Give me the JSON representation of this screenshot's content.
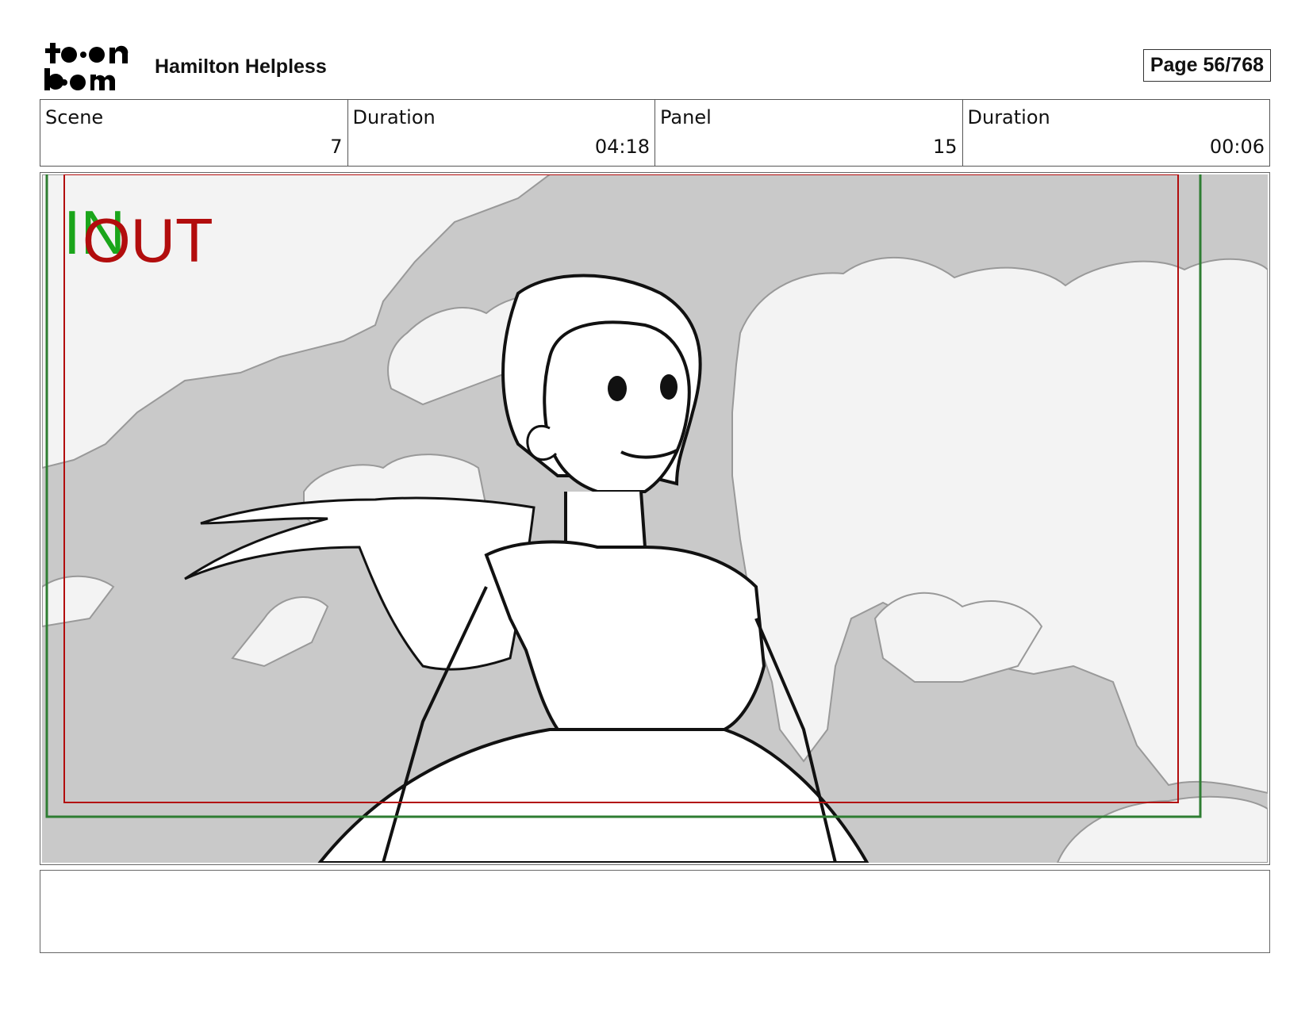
{
  "header": {
    "logo_text": "toon boom",
    "project_title": "Hamilton Helpless",
    "page_label": "Page",
    "page_value": "56/768"
  },
  "info": [
    {
      "label": "Scene",
      "value": "7"
    },
    {
      "label": "Duration",
      "value": "04:18"
    },
    {
      "label": "Panel",
      "value": "15"
    },
    {
      "label": "Duration",
      "value": "00:06"
    }
  ],
  "panel": {
    "in_marker": "IN",
    "out_marker": "OUT",
    "in_color": "#1aa51a",
    "out_color": "#b20d0d",
    "sky_color": "#c9c9c9",
    "cloud_color": "#f3f3f3"
  },
  "notes": {
    "text": ""
  }
}
